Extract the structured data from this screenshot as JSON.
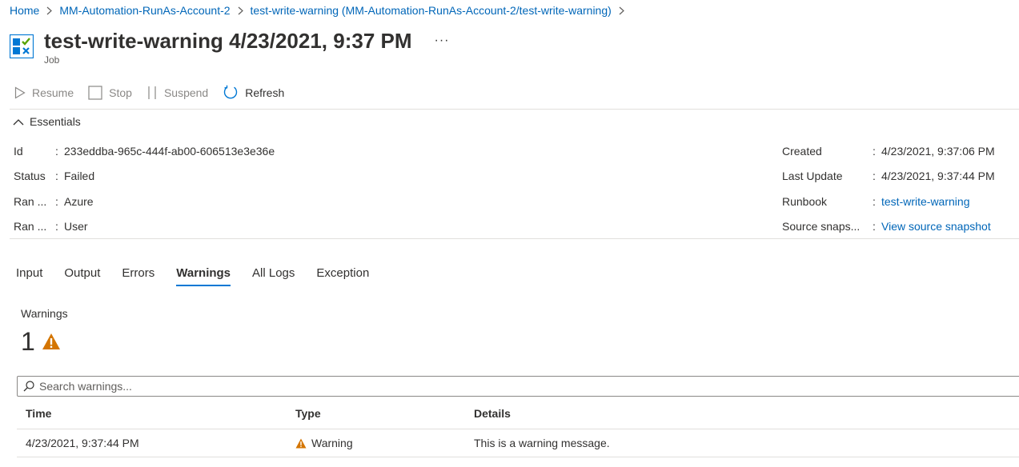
{
  "breadcrumb": [
    "Home",
    "MM-Automation-RunAs-Account-2",
    "test-write-warning (MM-Automation-RunAs-Account-2/test-write-warning)"
  ],
  "header": {
    "title": "test-write-warning 4/23/2021, 9:37 PM",
    "subtitle": "Job",
    "more": "···",
    "icon": "job-icon"
  },
  "toolbar": {
    "resume": "Resume",
    "stop": "Stop",
    "suspend": "Suspend",
    "refresh": "Refresh"
  },
  "essentials": {
    "heading": "Essentials",
    "left": [
      {
        "label": "Id",
        "value": "233eddba-965c-444f-ab00-606513e3e36e"
      },
      {
        "label": "Status",
        "value": "Failed"
      },
      {
        "label": "Ran ...",
        "value": "Azure"
      },
      {
        "label": "Ran ...",
        "value": "User"
      }
    ],
    "right": [
      {
        "label": "Created",
        "value": "4/23/2021, 9:37:06 PM"
      },
      {
        "label": "Last Update",
        "value": "4/23/2021, 9:37:44 PM"
      },
      {
        "label": "Runbook",
        "value": "test-write-warning"
      },
      {
        "label": "Source snaps...",
        "value": "View source snapshot"
      }
    ]
  },
  "tabs": [
    "Input",
    "Output",
    "Errors",
    "Warnings",
    "All Logs",
    "Exception"
  ],
  "active_tab": "Warnings",
  "warnings": {
    "label": "Warnings",
    "count": "1",
    "search_placeholder": "Search warnings...",
    "columns": [
      "Time",
      "Type",
      "Details"
    ],
    "rows": [
      {
        "time": "4/23/2021, 9:37:44 PM",
        "type": "Warning",
        "details": "This is a warning message."
      }
    ]
  },
  "colors": {
    "link": "#0066b8",
    "accent": "#0078d4",
    "warning": "#d47500"
  }
}
